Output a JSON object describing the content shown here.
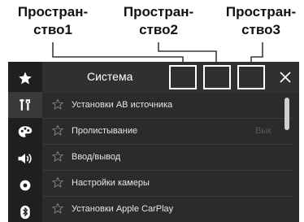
{
  "callouts": [
    {
      "line1": "Простран-",
      "line2": "ство1"
    },
    {
      "line1": "Простран-",
      "line2": "ство2"
    },
    {
      "line1": "Простран-",
      "line2": "ство3"
    }
  ],
  "header": {
    "title": "Система",
    "close_icon": "close-icon"
  },
  "sidebar": {
    "items": [
      {
        "icon": "star-icon"
      },
      {
        "icon": "tools-icon",
        "active": true
      },
      {
        "icon": "theme-icon"
      },
      {
        "icon": "volume-icon"
      },
      {
        "icon": "disc-icon"
      },
      {
        "icon": "bluetooth-icon"
      }
    ]
  },
  "menu": {
    "items": [
      {
        "label": "Установки AB источника",
        "value": ""
      },
      {
        "label": "Пролистывание",
        "value": "Вык"
      },
      {
        "label": "Ввод/вывод",
        "value": ""
      },
      {
        "label": "Настройки камеры",
        "value": ""
      },
      {
        "label": "Установки Apple CarPlay",
        "value": ""
      }
    ]
  }
}
